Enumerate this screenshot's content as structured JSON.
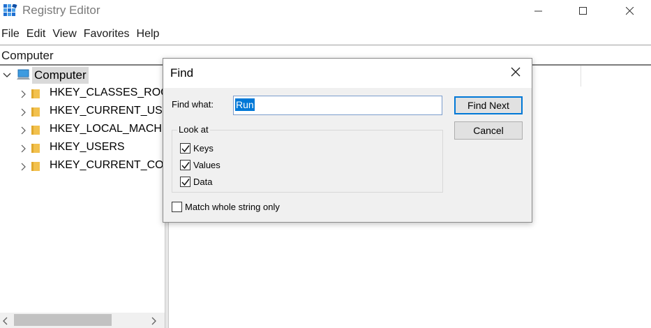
{
  "window": {
    "title": "Registry Editor",
    "app_icon": "registry-editor-icon"
  },
  "menu": [
    "File",
    "Edit",
    "View",
    "Favorites",
    "Help"
  ],
  "address_bar": {
    "path": "Computer"
  },
  "tree": {
    "root": "Computer",
    "nodes": [
      "HKEY_CLASSES_ROOT",
      "HKEY_CURRENT_USER",
      "HKEY_LOCAL_MACHINE",
      "HKEY_USERS",
      "HKEY_CURRENT_CONFIG"
    ]
  },
  "find_dialog": {
    "title": "Find",
    "find_what_label": "Find what:",
    "find_what_value": "Run",
    "look_at_label": "Look at",
    "options": [
      {
        "label": "Keys",
        "checked": true
      },
      {
        "label": "Values",
        "checked": true
      },
      {
        "label": "Data",
        "checked": true
      }
    ],
    "match_whole_label": "Match whole string only",
    "match_whole_checked": false,
    "find_next_label": "Find Next",
    "cancel_label": "Cancel"
  },
  "colors": {
    "selection": "#0078d7",
    "folder": "#f2c14e",
    "tree_selected_bg": "#d9d9d9"
  }
}
